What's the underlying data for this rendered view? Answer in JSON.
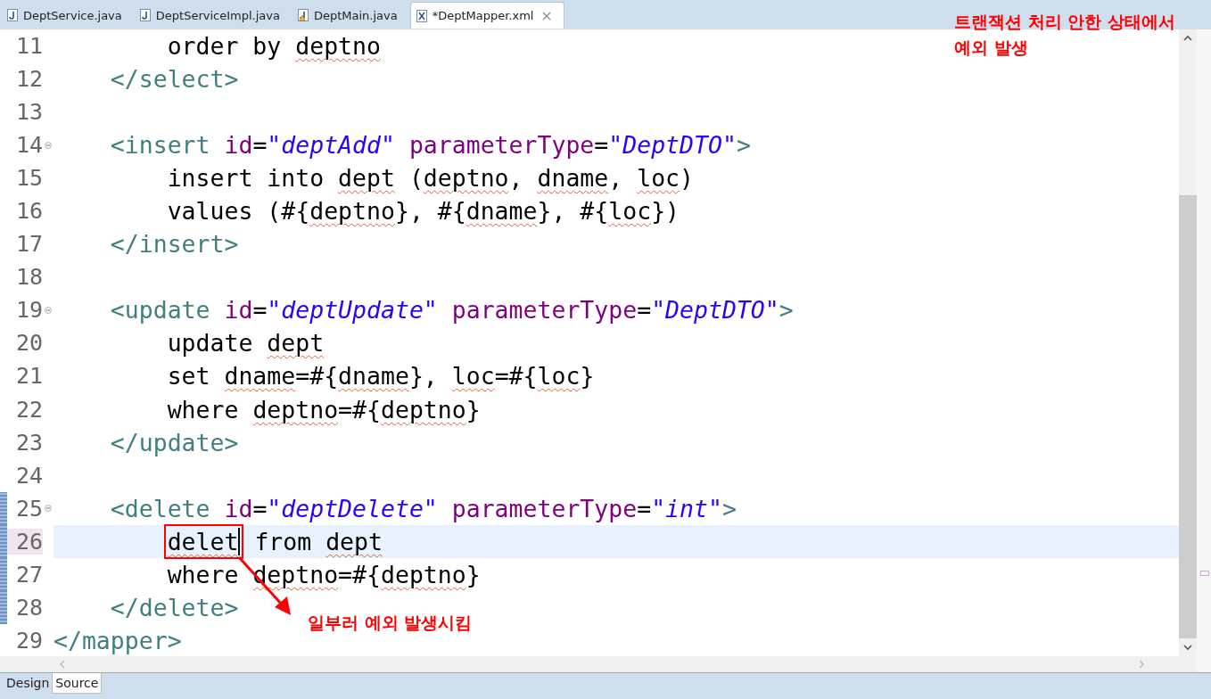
{
  "tabs": [
    {
      "label": "DeptService.java",
      "kind": "java",
      "warning": false,
      "selected": false
    },
    {
      "label": "DeptServiceImpl.java",
      "kind": "java",
      "warning": false,
      "selected": false
    },
    {
      "label": "DeptMain.java",
      "kind": "java",
      "warning": true,
      "selected": false
    },
    {
      "label": "*DeptMapper.xml",
      "kind": "xml",
      "warning": false,
      "selected": true
    }
  ],
  "editor": {
    "lines": [
      {
        "number": "11",
        "foldable": false,
        "current": false,
        "changed": false,
        "tokens": [
          {
            "kind": "text",
            "text": "        order by "
          },
          {
            "kind": "flagged",
            "text": "deptno"
          }
        ]
      },
      {
        "number": "12",
        "foldable": false,
        "current": false,
        "changed": false,
        "tokens": [
          {
            "kind": "tag",
            "text": "    </select>"
          }
        ]
      },
      {
        "number": "13",
        "foldable": false,
        "current": false,
        "changed": false
      },
      {
        "number": "14",
        "foldable": true,
        "current": false,
        "changed": false,
        "tokens": [
          {
            "kind": "tag",
            "text": "    <insert "
          },
          {
            "kind": "attr",
            "text": "id"
          },
          {
            "kind": "text",
            "text": "="
          },
          {
            "kind": "string",
            "text": "\"deptAdd\""
          },
          {
            "kind": "attr",
            "text": " parameterType"
          },
          {
            "kind": "text",
            "text": "="
          },
          {
            "kind": "string",
            "text": "\"DeptDTO\""
          },
          {
            "kind": "tag",
            "text": ">"
          }
        ]
      },
      {
        "number": "15",
        "foldable": false,
        "current": false,
        "changed": false,
        "tokens": [
          {
            "kind": "text",
            "text": "        insert into "
          },
          {
            "kind": "flagged",
            "text": "dept"
          },
          {
            "kind": "text",
            "text": " ("
          },
          {
            "kind": "flagged",
            "text": "deptno"
          },
          {
            "kind": "text",
            "text": ", "
          },
          {
            "kind": "flagged",
            "text": "dname"
          },
          {
            "kind": "text",
            "text": ", "
          },
          {
            "kind": "flagged",
            "text": "loc"
          },
          {
            "kind": "text",
            "text": ")"
          }
        ]
      },
      {
        "number": "16",
        "foldable": false,
        "current": false,
        "changed": false,
        "tokens": [
          {
            "kind": "text",
            "text": "        values (#{"
          },
          {
            "kind": "flagged",
            "text": "deptno"
          },
          {
            "kind": "text",
            "text": "}, #{"
          },
          {
            "kind": "flagged",
            "text": "dname"
          },
          {
            "kind": "text",
            "text": "}, #{"
          },
          {
            "kind": "flagged",
            "text": "loc"
          },
          {
            "kind": "text",
            "text": "})"
          }
        ]
      },
      {
        "number": "17",
        "foldable": false,
        "current": false,
        "changed": false,
        "tokens": [
          {
            "kind": "tag",
            "text": "    </insert>"
          }
        ]
      },
      {
        "number": "18",
        "foldable": false,
        "current": false,
        "changed": false
      },
      {
        "number": "19",
        "foldable": true,
        "current": false,
        "changed": false,
        "tokens": [
          {
            "kind": "tag",
            "text": "    <update "
          },
          {
            "kind": "attr",
            "text": "id"
          },
          {
            "kind": "text",
            "text": "="
          },
          {
            "kind": "string",
            "text": "\"deptUpdate\""
          },
          {
            "kind": "attr",
            "text": " parameterType"
          },
          {
            "kind": "text",
            "text": "="
          },
          {
            "kind": "string",
            "text": "\"DeptDTO\""
          },
          {
            "kind": "tag",
            "text": ">"
          }
        ]
      },
      {
        "number": "20",
        "foldable": false,
        "current": false,
        "changed": false,
        "tokens": [
          {
            "kind": "text",
            "text": "        update "
          },
          {
            "kind": "flagged",
            "text": "dept"
          }
        ]
      },
      {
        "number": "21",
        "foldable": false,
        "current": false,
        "changed": false,
        "tokens": [
          {
            "kind": "text",
            "text": "        set "
          },
          {
            "kind": "flagged",
            "text": "dname"
          },
          {
            "kind": "text",
            "text": "=#{"
          },
          {
            "kind": "flagged",
            "text": "dname"
          },
          {
            "kind": "text",
            "text": "}, "
          },
          {
            "kind": "flagged",
            "text": "loc"
          },
          {
            "kind": "text",
            "text": "=#{"
          },
          {
            "kind": "flagged",
            "text": "loc"
          },
          {
            "kind": "text",
            "text": "}"
          }
        ]
      },
      {
        "number": "22",
        "foldable": false,
        "current": false,
        "changed": false,
        "tokens": [
          {
            "kind": "text",
            "text": "        where "
          },
          {
            "kind": "flagged",
            "text": "deptno"
          },
          {
            "kind": "text",
            "text": "=#{"
          },
          {
            "kind": "flagged",
            "text": "deptno"
          },
          {
            "kind": "text",
            "text": "}"
          }
        ]
      },
      {
        "number": "23",
        "foldable": false,
        "current": false,
        "changed": false,
        "tokens": [
          {
            "kind": "tag",
            "text": "    </update>"
          }
        ]
      },
      {
        "number": "24",
        "foldable": false,
        "current": false,
        "changed": false
      },
      {
        "number": "25",
        "foldable": true,
        "current": false,
        "changed": true,
        "tokens": [
          {
            "kind": "tag",
            "text": "    <delete "
          },
          {
            "kind": "attr",
            "text": "id"
          },
          {
            "kind": "text",
            "text": "="
          },
          {
            "kind": "string",
            "text": "\"deptDelete\""
          },
          {
            "kind": "attr",
            "text": " parameterType"
          },
          {
            "kind": "text",
            "text": "="
          },
          {
            "kind": "string",
            "text": "\"int\""
          },
          {
            "kind": "tag",
            "text": ">"
          }
        ]
      },
      {
        "number": "26",
        "foldable": false,
        "current": true,
        "changed": true,
        "tokens": [
          {
            "kind": "boxed",
            "text": "        delet"
          },
          {
            "kind": "text",
            "text": " from "
          },
          {
            "kind": "flagged",
            "text": "dept"
          }
        ]
      },
      {
        "number": "27",
        "foldable": false,
        "current": false,
        "changed": true,
        "tokens": [
          {
            "kind": "text",
            "text": "        where "
          },
          {
            "kind": "flagged",
            "text": "deptno"
          },
          {
            "kind": "text",
            "text": "=#{"
          },
          {
            "kind": "flagged",
            "text": "deptno"
          },
          {
            "kind": "text",
            "text": "}"
          }
        ]
      },
      {
        "number": "28",
        "foldable": false,
        "current": false,
        "changed": true,
        "tokens": [
          {
            "kind": "tag",
            "text": "    </delete>"
          }
        ]
      },
      {
        "number": "29",
        "foldable": false,
        "current": false,
        "changed": false,
        "tokens": [
          {
            "kind": "tag",
            "text": "</mapper>"
          }
        ]
      }
    ]
  },
  "annotations": {
    "note": "트랜잭션 처리 안한 상태에서\n예외 발생",
    "arrow_label": "일부러 예외 발생시킴"
  },
  "bottom_tabs": [
    {
      "label": "Design",
      "selected": false
    },
    {
      "label": "Source",
      "selected": true
    }
  ]
}
